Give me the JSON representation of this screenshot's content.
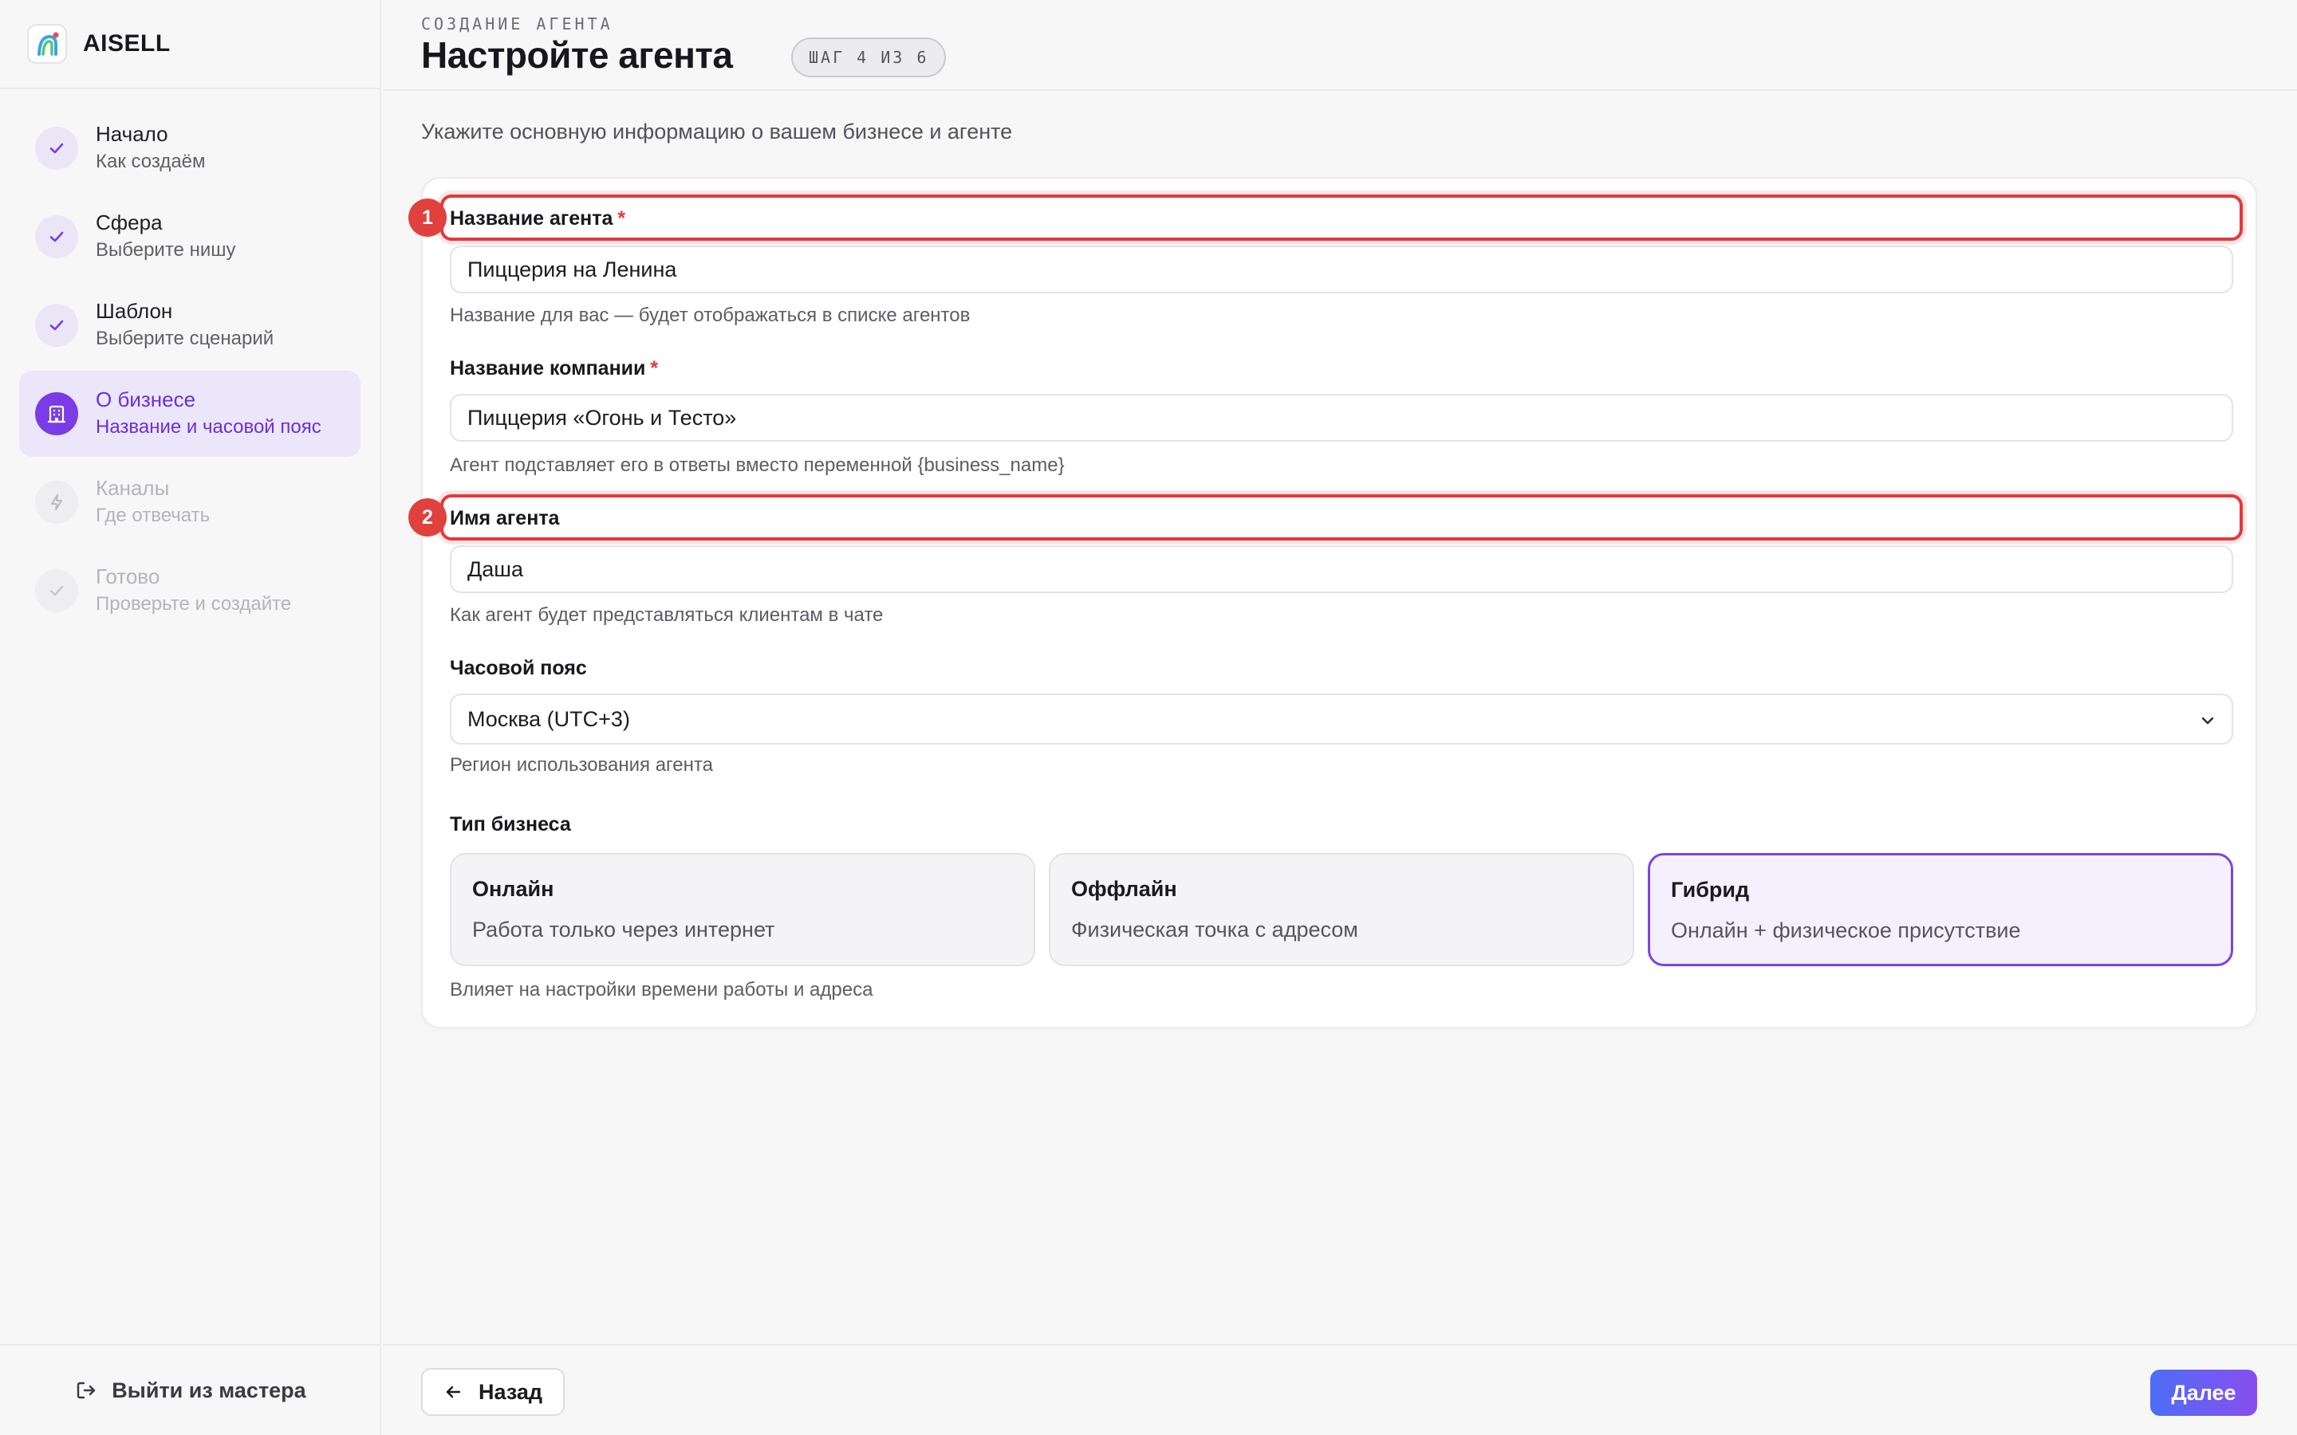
{
  "brand": {
    "name": "AISELL"
  },
  "header": {
    "eyebrow": "СОЗДАНИЕ АГЕНТА",
    "title": "Настройте агента",
    "step_badge": "ШАГ 4 ИЗ 6"
  },
  "steps": [
    {
      "title": "Начало",
      "subtitle": "Как создаём",
      "state": "done"
    },
    {
      "title": "Сфера",
      "subtitle": "Выберите нишу",
      "state": "done"
    },
    {
      "title": "Шаблон",
      "subtitle": "Выберите сценарий",
      "state": "done"
    },
    {
      "title": "О бизнесе",
      "subtitle": "Название и часовой пояс",
      "state": "active"
    },
    {
      "title": "Каналы",
      "subtitle": "Где отвечать",
      "state": "pending"
    },
    {
      "title": "Готово",
      "subtitle": "Проверьте и создайте",
      "state": "pending"
    }
  ],
  "sidebar": {
    "exit_label": "Выйти из мастера"
  },
  "main": {
    "intro": "Укажите основную информацию о вашем бизнесе и агенте",
    "fields": {
      "agent_name": {
        "label": "Название агента",
        "required": "*",
        "value": "Пиццерия на Ленина",
        "hint": "Название для вас — будет отображаться в списке агентов",
        "marker": "1"
      },
      "company_name": {
        "label": "Название компании",
        "required": "*",
        "value": "Пиццерия «Огонь и Тесто»",
        "hint": "Агент подставляет его в ответы вместо переменной {business_name}"
      },
      "persona_name": {
        "label": "Имя агента",
        "value": "Даша",
        "hint": "Как агент будет представляться клиентам в чате",
        "marker": "2"
      },
      "timezone": {
        "label": "Часовой пояс",
        "value": "Москва (UTC+3)",
        "hint": "Регион использования агента"
      }
    },
    "business_type": {
      "label": "Тип бизнеса",
      "options": [
        {
          "title": "Онлайн",
          "desc": "Работа только через интернет"
        },
        {
          "title": "Оффлайн",
          "desc": "Физическая точка с адресом"
        },
        {
          "title": "Гибрид",
          "desc": "Онлайн + физическое присутствие"
        }
      ],
      "selected": "Гибрид",
      "hint": "Влияет на настройки времени работы и адреса"
    }
  },
  "footer": {
    "back_label": "Назад",
    "next_label": "Далее"
  },
  "colors": {
    "accent": "#7a3ce6",
    "highlight": "#e5383b",
    "background": "#f7f7f8"
  }
}
